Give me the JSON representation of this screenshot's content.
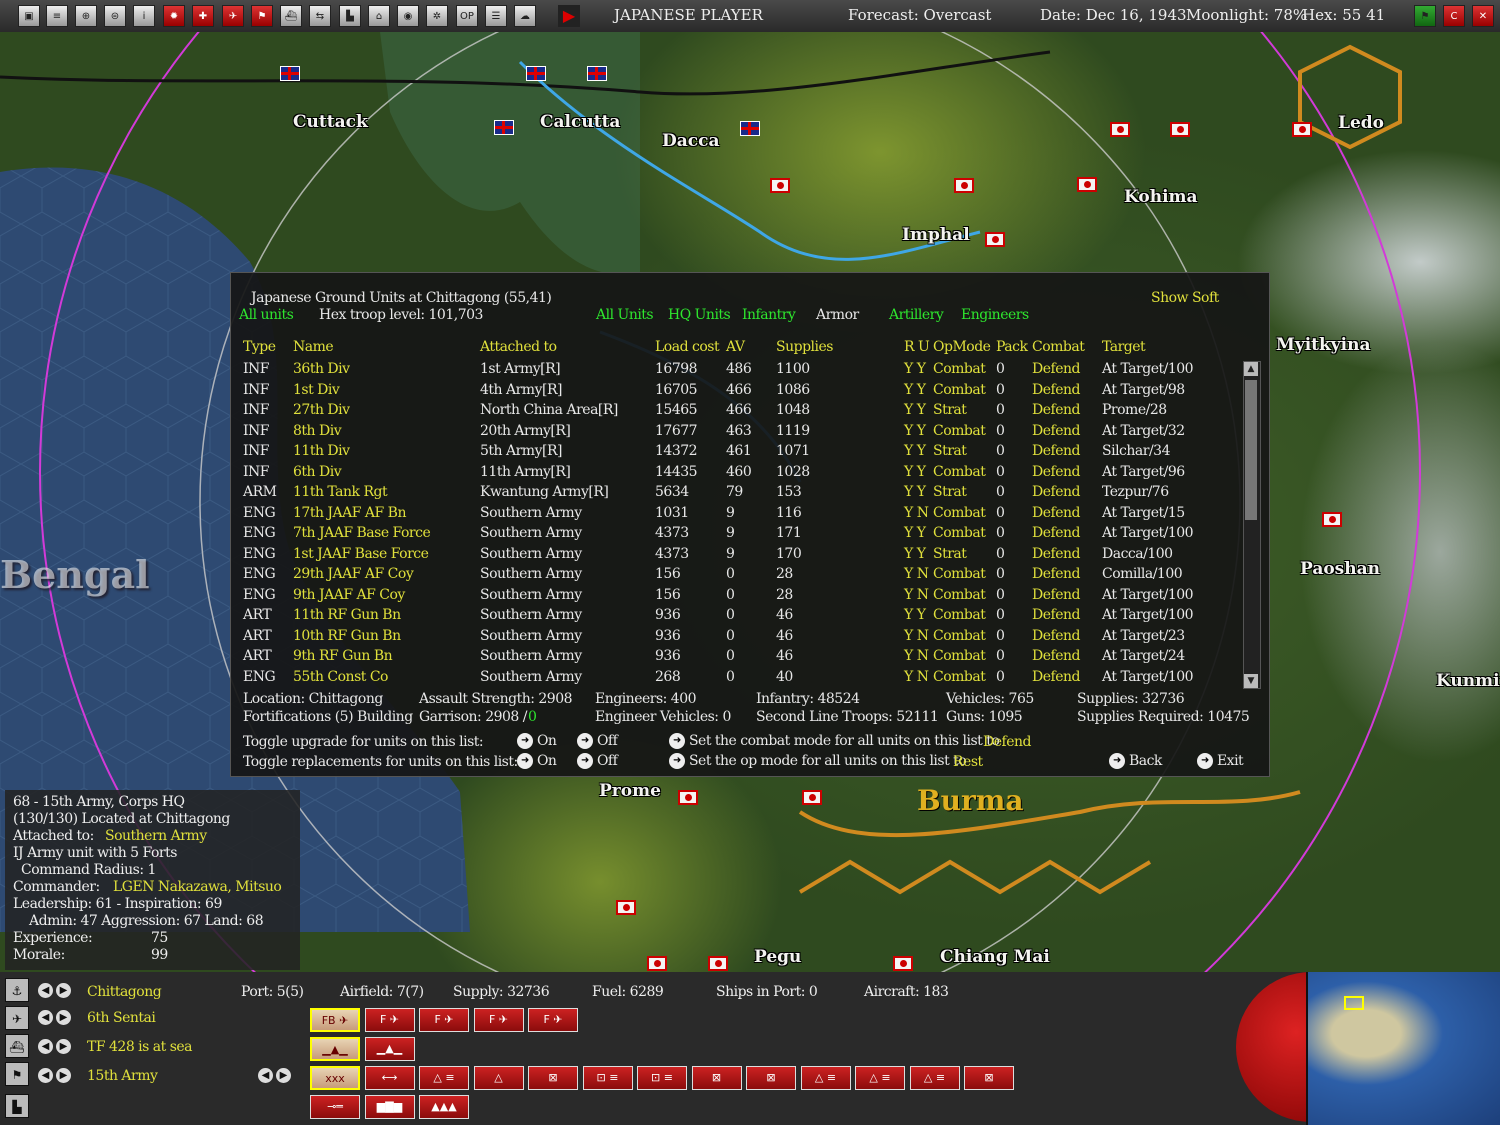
{
  "topbar": {
    "player": "JAPANESE PLAYER",
    "forecast": "Forecast: Overcast",
    "date": "Date: Dec 16, 1943",
    "moonlight": "Moonlight: 78%",
    "hex": "Hex: 55 41",
    "icons": [
      "save-icon",
      "report-icon",
      "ground-icon",
      "ships-icon",
      "info-icon",
      "japan-flag-icon",
      "red-plus-icon",
      "plane-icon",
      "flag-icon",
      "ship-icon",
      "cargo-icon",
      "base-icon",
      "factory-icon",
      "globe-icon",
      "network-icon",
      "op-icon",
      "list-icon",
      "cloud-icon",
      "end-turn-icon"
    ],
    "right_icons": [
      "flag-icon",
      "c-icon",
      "close-icon"
    ]
  },
  "map": {
    "cities": [
      "Cuttack",
      "Calcutta",
      "Dacca",
      "Imphal",
      "Kohima",
      "Ledo",
      "Myitkyina",
      "Paoshan",
      "Kunmin",
      "Prome",
      "Pegu",
      "Chiang Mai"
    ],
    "region_label": "Bengal",
    "country_label": "Burma"
  },
  "dialog": {
    "title": "Japanese Ground Units at Chittagong (55,41)",
    "show_soft": "Show Soft",
    "filter_all": "All units",
    "hex_troop": "Hex troop level: 101,703",
    "filters": {
      "all_units": "All Units",
      "hq_units": "HQ Units",
      "infantry": "Infantry",
      "armor": "Armor",
      "artillery": "Artillery",
      "engineers": "Engineers"
    },
    "columns": {
      "type": "Type",
      "name": "Name",
      "attached": "Attached to",
      "load": "Load cost",
      "av": "AV",
      "supplies": "Supplies",
      "r_u": "R U",
      "opmode": "OpMode",
      "pack": "Pack",
      "combat": "Combat",
      "target": "Target"
    },
    "rows": [
      {
        "type": "INF",
        "name": "36th Div",
        "attached": "1st Army[R]",
        "load": "16798",
        "av": "486",
        "supplies": "1100",
        "ru": "Y Y",
        "opmode": "Combat",
        "pack": "0",
        "combat": "Defend",
        "target": "At Target/100"
      },
      {
        "type": "INF",
        "name": "1st Div",
        "attached": "4th Army[R]",
        "load": "16705",
        "av": "466",
        "supplies": "1086",
        "ru": "Y Y",
        "opmode": "Combat",
        "pack": "0",
        "combat": "Defend",
        "target": "At Target/98"
      },
      {
        "type": "INF",
        "name": "27th Div",
        "attached": "North China Area[R]",
        "load": "15465",
        "av": "466",
        "supplies": "1048",
        "ru": "Y Y",
        "opmode": "Strat",
        "pack": "0",
        "combat": "Defend",
        "target": "Prome/28"
      },
      {
        "type": "INF",
        "name": "8th Div",
        "attached": "20th Army[R]",
        "load": "17677",
        "av": "463",
        "supplies": "1119",
        "ru": "Y Y",
        "opmode": "Combat",
        "pack": "0",
        "combat": "Defend",
        "target": "At Target/32"
      },
      {
        "type": "INF",
        "name": "11th Div",
        "attached": "5th Army[R]",
        "load": "14372",
        "av": "461",
        "supplies": "1071",
        "ru": "Y Y",
        "opmode": "Strat",
        "pack": "0",
        "combat": "Defend",
        "target": "Silchar/34"
      },
      {
        "type": "INF",
        "name": "6th Div",
        "attached": "11th Army[R]",
        "load": "14435",
        "av": "460",
        "supplies": "1028",
        "ru": "Y Y",
        "opmode": "Combat",
        "pack": "0",
        "combat": "Defend",
        "target": "At Target/96"
      },
      {
        "type": "ARM",
        "name": "11th Tank Rgt",
        "attached": "Kwantung Army[R]",
        "load": "5634",
        "av": "79",
        "supplies": "153",
        "ru": "Y Y",
        "opmode": "Strat",
        "pack": "0",
        "combat": "Defend",
        "target": "Tezpur/76"
      },
      {
        "type": "ENG",
        "name": "17th JAAF AF Bn",
        "attached": "Southern Army",
        "load": "1031",
        "av": "9",
        "supplies": "116",
        "ru": "Y N",
        "opmode": "Combat",
        "pack": "0",
        "combat": "Defend",
        "target": "At Target/15"
      },
      {
        "type": "ENG",
        "name": "7th JAAF Base Force",
        "attached": "Southern Army",
        "load": "4373",
        "av": "9",
        "supplies": "171",
        "ru": "Y Y",
        "opmode": "Combat",
        "pack": "0",
        "combat": "Defend",
        "target": "At Target/100"
      },
      {
        "type": "ENG",
        "name": "1st JAAF Base Force",
        "attached": "Southern Army",
        "load": "4373",
        "av": "9",
        "supplies": "170",
        "ru": "Y Y",
        "opmode": "Strat",
        "pack": "0",
        "combat": "Defend",
        "target": "Dacca/100"
      },
      {
        "type": "ENG",
        "name": "29th JAAF AF Coy",
        "attached": "Southern Army",
        "load": "156",
        "av": "0",
        "supplies": "28",
        "ru": "Y N",
        "opmode": "Combat",
        "pack": "0",
        "combat": "Defend",
        "target": "Comilla/100"
      },
      {
        "type": "ENG",
        "name": "9th JAAF AF Coy",
        "attached": "Southern Army",
        "load": "156",
        "av": "0",
        "supplies": "28",
        "ru": "Y N",
        "opmode": "Combat",
        "pack": "0",
        "combat": "Defend",
        "target": "At Target/100"
      },
      {
        "type": "ART",
        "name": "11th RF Gun Bn",
        "attached": "Southern Army",
        "load": "936",
        "av": "0",
        "supplies": "46",
        "ru": "Y Y",
        "opmode": "Combat",
        "pack": "0",
        "combat": "Defend",
        "target": "At Target/100"
      },
      {
        "type": "ART",
        "name": "10th RF Gun Bn",
        "attached": "Southern Army",
        "load": "936",
        "av": "0",
        "supplies": "46",
        "ru": "Y N",
        "opmode": "Combat",
        "pack": "0",
        "combat": "Defend",
        "target": "At Target/23"
      },
      {
        "type": "ART",
        "name": "9th RF Gun Bn",
        "attached": "Southern Army",
        "load": "936",
        "av": "0",
        "supplies": "46",
        "ru": "Y N",
        "opmode": "Combat",
        "pack": "0",
        "combat": "Defend",
        "target": "At Target/24"
      },
      {
        "type": "ENG",
        "name": "55th Const Co",
        "attached": "Southern Army",
        "load": "268",
        "av": "0",
        "supplies": "40",
        "ru": "Y N",
        "opmode": "Combat",
        "pack": "0",
        "combat": "Defend",
        "target": "At Target/100"
      }
    ],
    "summary": {
      "location": "Location: Chittagong",
      "fortifications": "Fortifications (5) Building",
      "assault": "Assault Strength: 2908",
      "garrison": "Garrison: 2908 /",
      "garrison_extra": "0",
      "engineers": "Engineers: 400",
      "eng_vehicles": "Engineer Vehicles: 0",
      "infantry": "Infantry: 48524",
      "second_line": "Second Line Troops: 52111",
      "vehicles": "Vehicles: 765",
      "guns": "Guns: 1095",
      "supplies": "Supplies: 32736",
      "supplies_req": "Supplies Required: 10475"
    },
    "controls": {
      "toggle_upgrade": "Toggle upgrade for units on this list:",
      "toggle_repl": "Toggle replacements for units on this list:",
      "on": "On",
      "off": "Off",
      "set_combat": "Set the combat mode for all units on this list to",
      "combat_value": "Defend",
      "set_op": "Set the op mode for all units on this list to",
      "op_value": "Rest",
      "back": "Back",
      "exit": "Exit"
    }
  },
  "infobox": {
    "line1": "68 - 15th Army, Corps HQ",
    "line2": "(130/130) Located at Chittagong",
    "attached_label": "Attached to:",
    "attached_value": "Southern Army",
    "line4": "IJ Army unit with 5 Forts",
    "line5": "Command Radius: 1",
    "commander_label": "Commander:",
    "commander_value": "LGEN Nakazawa, Mitsuo",
    "line7": "Leadership: 61 - Inspiration: 69",
    "line8": "Admin: 47  Aggression: 67  Land: 68",
    "experience_label": "Experience:",
    "experience_value": "75",
    "morale_label": "Morale:",
    "morale_value": "99"
  },
  "bottombar": {
    "base": "Chittagong",
    "port": "Port: 5(5)",
    "airfield": "Airfield: 7(7)",
    "supply": "Supply: 32736",
    "fuel": "Fuel: 6289",
    "ships": "Ships in Port: 0",
    "aircraft": "Aircraft: 183",
    "air_unit": "6th Sentai",
    "tf": "TF 428 is at sea",
    "army": "15th Army",
    "air_buttons": [
      "FB ✈",
      "F ✈",
      "F ✈",
      "F ✈",
      "F ✈"
    ],
    "ship_buttons": [
      "▁▲▁",
      "▁▲▁"
    ],
    "land_buttons": [
      "xxx",
      "⟷",
      "△ ≡",
      "△",
      "⊠",
      "⊡ ≡",
      "⊡ ≡",
      "⊠",
      "⊠",
      "△ ≡",
      "△ ≡",
      "△ ≡",
      "⊠"
    ],
    "other_buttons": [
      "⊸═",
      "▆▇▆",
      "▲▲▲"
    ]
  }
}
